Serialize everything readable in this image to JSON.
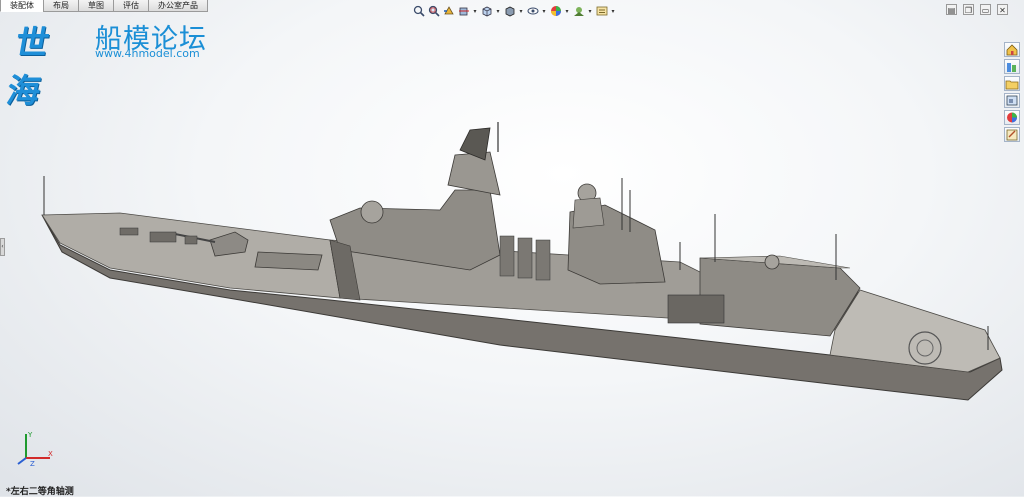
{
  "tabs": [
    {
      "label": "装配体",
      "active": true
    },
    {
      "label": "布局",
      "active": false
    },
    {
      "label": "草图",
      "active": false
    },
    {
      "label": "评估",
      "active": false
    },
    {
      "label": "办公室产品",
      "active": false
    }
  ],
  "watermark": {
    "title": "船模论坛",
    "url": "www.4hmodel.com"
  },
  "toolbar": {
    "icons": [
      "zoom-to-fit-icon",
      "zoom-area-icon",
      "previous-view-icon",
      "section-view-icon",
      "view-orientation-icon",
      "display-style-icon",
      "hide-show-icon",
      "edit-appearance-icon",
      "apply-scene-icon",
      "view-settings-icon"
    ]
  },
  "window_controls": {
    "icons": [
      "tile-icon",
      "restore-icon",
      "minimize-icon",
      "close-icon"
    ]
  },
  "taskpane": {
    "icons": [
      "home-icon",
      "design-library-icon",
      "file-explorer-icon",
      "view-palette-icon",
      "appearances-icon",
      "custom-properties-icon"
    ]
  },
  "triad": {
    "axes": [
      "X",
      "Y",
      "Z"
    ]
  },
  "view": {
    "label": "*左右二等角轴测"
  },
  "colors": {
    "hull": "#7b7873",
    "deck": "#b4b1ab",
    "superstructure": "#8f8c86",
    "logo": "#1b8fd6",
    "background": "#f4f6f8"
  }
}
